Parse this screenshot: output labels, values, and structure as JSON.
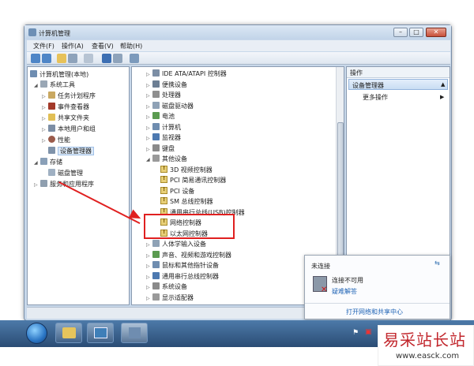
{
  "window": {
    "title": "计算机管理"
  },
  "menu": [
    "文件(F)",
    "操作(A)",
    "查看(V)",
    "帮助(H)"
  ],
  "left_tree": {
    "root": "计算机管理(本地)",
    "system_tools": "系统工具",
    "items": [
      "任务计划程序",
      "事件查看器",
      "共享文件夹",
      "本地用户和组",
      "性能",
      "设备管理器"
    ],
    "storage": "存储",
    "disk_mgmt": "磁盘管理",
    "services": "服务和应用程序"
  },
  "device_tree": {
    "top": [
      "IDE ATA/ATAPI 控制器",
      "便携设备",
      "处理器",
      "磁盘驱动器",
      "电池",
      "计算机",
      "监视器",
      "键盘"
    ],
    "other_devices": "其他设备",
    "other_children": [
      "3D 视频控制器",
      "PCI 简易通讯控制器",
      "PCI 设备",
      "SM 总线控制器",
      "通用串行总线(USB)控制器",
      "网络控制器",
      "以太网控制器"
    ],
    "bottom": [
      "人体学输入设备",
      "声音、视频和游戏控制器",
      "鼠标和其他指针设备",
      "通用串行总线控制器",
      "系统设备",
      "显示适配器"
    ]
  },
  "actions": {
    "header": "操作",
    "selected": "设备管理器",
    "more": "更多操作"
  },
  "network_popup": {
    "status": "未连接",
    "line1": "连接不可用",
    "link": "疑难解答",
    "footer": "打开网络和共享中心"
  },
  "watermark": {
    "brand": "易采站长站",
    "url": "www.easck.com"
  }
}
